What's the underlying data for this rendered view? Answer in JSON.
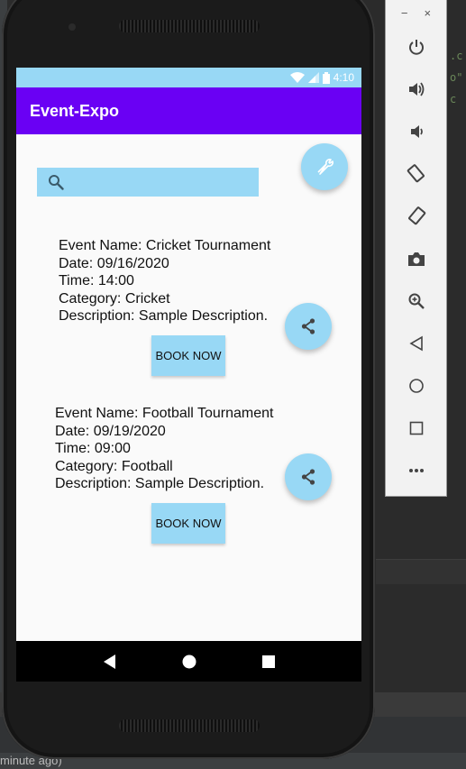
{
  "ide": {
    "status_text": "minute ago)",
    "code_fragments": [
      ".c",
      "o\"",
      "c"
    ]
  },
  "phone": {
    "status_bar": {
      "time": "4:10"
    },
    "app_bar": {
      "title": "Event-Expo"
    },
    "search": {
      "placeholder": "",
      "value": ""
    },
    "events": [
      {
        "name_line": "Event Name: Cricket Tournament",
        "date_line": "Date: 09/16/2020",
        "time_line": "Time: 14:00",
        "category_line": "Category: Cricket",
        "description_line": "Description: Sample Description.",
        "book_label": "BOOK NOW"
      },
      {
        "name_line": "Event Name: Football Tournament",
        "date_line": "Date: 09/19/2020",
        "time_line": "Time: 09:00",
        "category_line": "Category: Football",
        "description_line": "Description: Sample Description.",
        "book_label": "BOOK NOW"
      }
    ]
  },
  "emulator_toolbar": {
    "minimize_label": "−",
    "close_label": "×",
    "buttons": [
      "power-icon",
      "volume-up-icon",
      "volume-down-icon",
      "rotate-left-icon",
      "rotate-right-icon",
      "camera-icon",
      "zoom-icon",
      "back-icon",
      "home-icon",
      "overview-icon",
      "more-icon"
    ]
  },
  "colors": {
    "accent": "#98d8f5",
    "app_bar": "#6a00f4",
    "ide_bg": "#2b2b2b"
  }
}
